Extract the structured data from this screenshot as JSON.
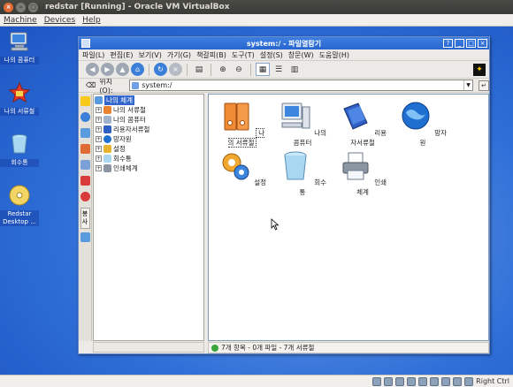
{
  "host": {
    "title": "redstar [Running] - Oracle VM VirtualBox",
    "menu": [
      "Machine",
      "Devices",
      "Help"
    ],
    "status_key": "Right Ctrl"
  },
  "desktop": {
    "icons": [
      {
        "label": "나의 콤퓨터",
        "icon": "computer-icon"
      },
      {
        "label": "나의 서류철",
        "icon": "documents-star-icon"
      },
      {
        "label": "회수통",
        "icon": "trash-icon"
      },
      {
        "label": "Redstar Desktop ...",
        "icon": "disc-icon"
      }
    ]
  },
  "explorer": {
    "title": "system:/ - 파일열람기",
    "menu": [
      "파일(L)",
      "편집(E)",
      "보기(V)",
      "가기(G)",
      "책갈피(B)",
      "도구(T)",
      "설정(S)",
      "창문(W)",
      "도움말(H)"
    ],
    "location_label": "위치(O):",
    "location_value": "system:/",
    "tree": {
      "root": "나의 체계",
      "children": [
        "나의 서류철",
        "나의 콤퓨터",
        "리용자서류철",
        "망자원",
        "설정",
        "회수통",
        "인쇄체계"
      ]
    },
    "files": [
      {
        "label": "나의 서류철",
        "icon": "binder-icon",
        "selected": true
      },
      {
        "label": "나의 콤퓨터",
        "icon": "computer-icon",
        "selected": false
      },
      {
        "label": "리용자서류철",
        "icon": "books-icon",
        "selected": false
      },
      {
        "label": "망자원",
        "icon": "globe-icon",
        "selected": false
      },
      {
        "label": "설정",
        "icon": "settings-icon",
        "selected": false
      },
      {
        "label": "회수통",
        "icon": "trash-icon",
        "selected": false
      },
      {
        "label": "인쇄체계",
        "icon": "printer-icon",
        "selected": false
      }
    ],
    "status_text": "7개 항목 - 0개 파일 - 7개 서류철",
    "side_tab": "봉사"
  },
  "colors": {
    "window_title": "#2766cf",
    "selection": "#3266cc",
    "desktop": "#2f6fd8"
  }
}
